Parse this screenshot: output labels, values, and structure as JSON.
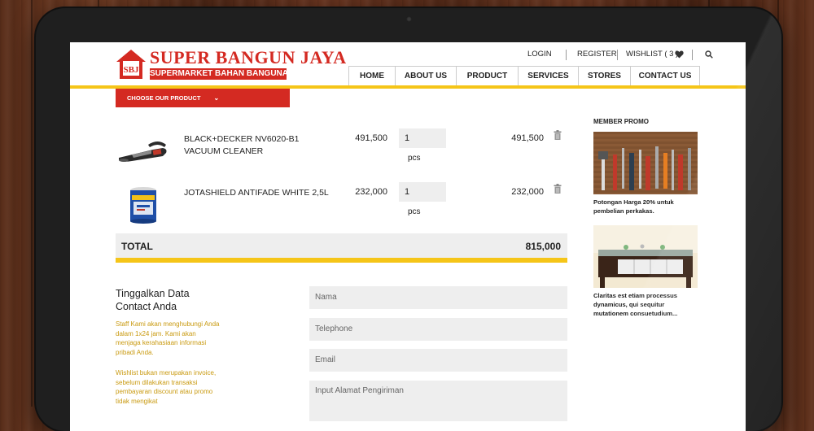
{
  "brand": {
    "initials": "SBJ",
    "title": "SUPER BANGUN JAYA",
    "subtitle": "SUPERMARKET BAHAN BANGUNAN"
  },
  "topnav": {
    "login": "LOGIN",
    "register": "REGISTER",
    "wishlist": "WISHLIST ( 3 )"
  },
  "mainnav": [
    "HOME",
    "ABOUT US",
    "PRODUCT",
    "SERVICES",
    "STORES",
    "CONTACT US"
  ],
  "choose_product": "CHOOSE OUR PRODUCT",
  "cart": {
    "items": [
      {
        "name": "BLACK+DECKER NV6020-B1 VACUUM CLEANER",
        "price": "491,500",
        "qty": "1",
        "unit": "pcs",
        "total": "491,500"
      },
      {
        "name": "JOTASHIELD ANTIFADE WHITE 2,5L",
        "price": "232,000",
        "qty": "1",
        "unit": "pcs",
        "total": "232,000"
      }
    ],
    "total_label": "TOTAL",
    "total_value": "815,000"
  },
  "form": {
    "title": "Tinggalkan Data Contact Anda",
    "note1": "Staff Kami akan menghubungi Anda dalam 1x24 jam. Kami akan menjaga kerahasiaan informasi pribadi Anda.",
    "note2": "Wishlist bukan merupakan invoice, sebelum dilakukan transaksi pembayaran discount atau promo tidak mengikat",
    "fields": {
      "name": "Nama",
      "phone": "Telephone",
      "email": "Email",
      "address": "Input Alamat Pengiriman"
    }
  },
  "sidebar": {
    "title": "MEMBER PROMO",
    "promos": [
      {
        "text": "Potongan Harga 20% untuk pembelian perkakas."
      },
      {
        "text": "Claritas est etiam processus dynamicus, qui sequitur mutationem consuetudium..."
      }
    ]
  },
  "colors": {
    "brand_red": "#d42a22",
    "accent_yellow": "#f5c518",
    "note_gold": "#c99a10"
  }
}
